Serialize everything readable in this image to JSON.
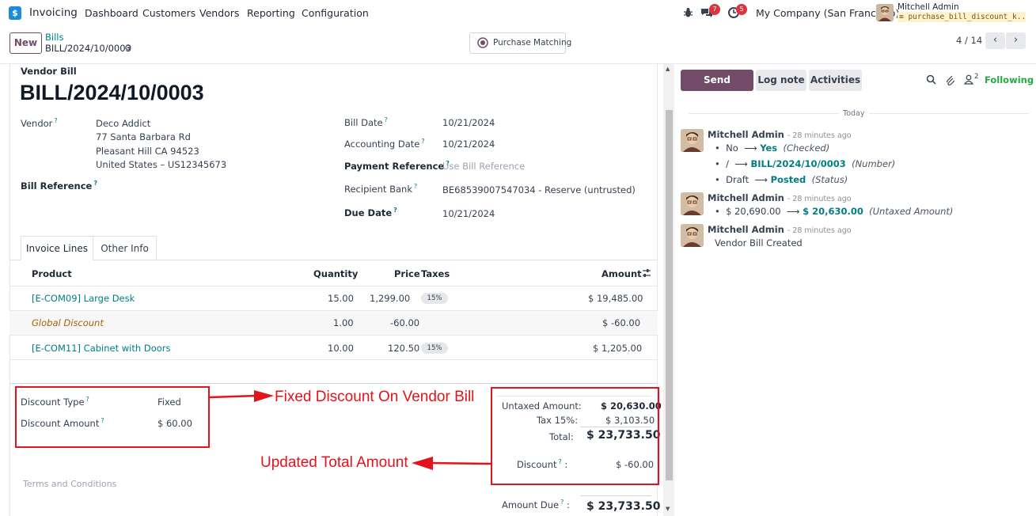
{
  "navbar": {
    "app_name": "Invoicing",
    "menu": [
      "Dashboard",
      "Customers",
      "Vendors",
      "Reporting",
      "Configuration"
    ],
    "messages_count": "7",
    "activities_count": "5",
    "company": "My Company (San Francisco)",
    "user_name": "Mitchell Admin",
    "database": "purchase_bill_discount_k..."
  },
  "control": {
    "new_label": "New",
    "breadcrumb_parent": "Bills",
    "breadcrumb_current": "BILL/2024/10/0003",
    "purchase_matching_label": "Purchase Matching",
    "pager": "4 / 14"
  },
  "form": {
    "doc_type": "Vendor Bill",
    "title": "BILL/2024/10/0003",
    "vendor_label": "Vendor",
    "vendor_name": "Deco Addict",
    "vendor_address": [
      "77 Santa Barbara Rd",
      "Pleasant Hill CA 94523",
      "United States – US12345673"
    ],
    "bill_reference_label": "Bill Reference",
    "bill_date_label": "Bill Date",
    "bill_date": "10/21/2024",
    "accounting_date_label": "Accounting Date",
    "accounting_date": "10/21/2024",
    "payment_reference_label": "Payment Reference",
    "payment_reference_placeholder": "Use Bill Reference",
    "recipient_bank_label": "Recipient Bank",
    "recipient_bank": "BE68539007547034 - Reserve (untrusted)",
    "due_date_label": "Due Date",
    "due_date": "10/21/2024",
    "tabs": [
      "Invoice Lines",
      "Other Info"
    ],
    "columns": {
      "product": "Product",
      "quantity": "Quantity",
      "price": "Price",
      "taxes": "Taxes",
      "amount": "Amount"
    },
    "lines": [
      {
        "product": "[E-COM09] Large Desk",
        "quantity": "15.00",
        "price": "1,299.00",
        "tax": "15%",
        "amount": "$ 19,485.00"
      },
      {
        "product": "Global Discount",
        "quantity": "1.00",
        "price": "-60.00",
        "tax": "",
        "amount": "$ -60.00"
      },
      {
        "product": "[E-COM11] Cabinet with Doors",
        "quantity": "10.00",
        "price": "120.50",
        "tax": "15%",
        "amount": "$ 1,205.00"
      }
    ],
    "discount_type_label": "Discount Type",
    "discount_type": "Fixed",
    "discount_amount_label": "Discount Amount",
    "discount_amount": "$ 60.00",
    "terms_placeholder": "Terms and Conditions",
    "totals": {
      "untaxed_label": "Untaxed Amount:",
      "untaxed": "$ 20,630.00",
      "tax_label": "Tax 15%:",
      "tax": "$ 3,103.50",
      "total_label": "Total:",
      "total": "$ 23,733.50",
      "discount_label": "Discount",
      "discount": "$ -60.00",
      "amount_due_label": "Amount Due",
      "amount_due": "$ 23,733.50"
    }
  },
  "annotations": {
    "fixed_discount": "Fixed Discount On Vendor Bill",
    "updated_total": "Updated Total Amount",
    "color": "#e3131b"
  },
  "chatter": {
    "send_message": "Send message",
    "log_note": "Log note",
    "activities": "Activities",
    "followers_count": "2",
    "following": "Following",
    "today": "Today",
    "messages": [
      {
        "author": "Mitchell Admin",
        "time": "- 28 minutes ago",
        "changes": [
          {
            "old": "No",
            "new": "Yes",
            "field": "(Checked)"
          },
          {
            "old": "/",
            "new": "BILL/2024/10/0003",
            "field": "(Number)"
          },
          {
            "old": "Draft",
            "new": "Posted",
            "field": "(Status)"
          }
        ]
      },
      {
        "author": "Mitchell Admin",
        "time": "- 28 minutes ago",
        "changes": [
          {
            "old": "$ 20,690.00",
            "new": "$ 20,630.00",
            "field": "(Untaxed Amount)"
          }
        ]
      },
      {
        "author": "Mitchell Admin",
        "time": "- 28 minutes ago",
        "body": "Vendor Bill Created"
      }
    ]
  },
  "colors": {
    "brand": "#714b67",
    "link": "#017e84",
    "discount_line": "#a16207"
  }
}
